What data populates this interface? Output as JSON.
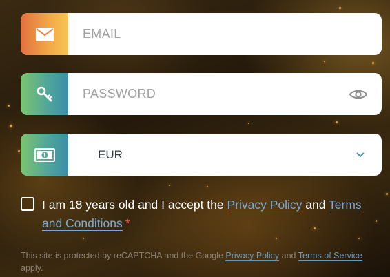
{
  "form": {
    "email": {
      "placeholder": "EMAIL",
      "value": ""
    },
    "password": {
      "placeholder": "PASSWORD",
      "value": ""
    },
    "currency": {
      "selected": "EUR"
    },
    "terms": {
      "prefix": "I am 18 years old and I accept the ",
      "privacy_link": "Privacy Policy",
      "conjunction": " and ",
      "terms_link": "Terms and Conditions",
      "required_mark": "*"
    },
    "recaptcha": {
      "prefix": "This site is protected by reCAPTCHA and the Google ",
      "privacy_link": "Privacy Policy",
      "conjunction": " and ",
      "terms_link": "Terms of Service",
      "suffix": " apply."
    }
  },
  "icons": {
    "email": "envelope-icon",
    "password": "key-icon",
    "currency": "banknote-icon",
    "show_password": "eye-icon",
    "dropdown": "chevron-down-icon"
  },
  "colors": {
    "email_badge_start": "#e2713f",
    "email_badge_end": "#f6c453",
    "green_badge_start": "#7cc46f",
    "green_badge_end": "#3b8fa6",
    "link": "#79a9d6",
    "required": "#e35a4e"
  }
}
